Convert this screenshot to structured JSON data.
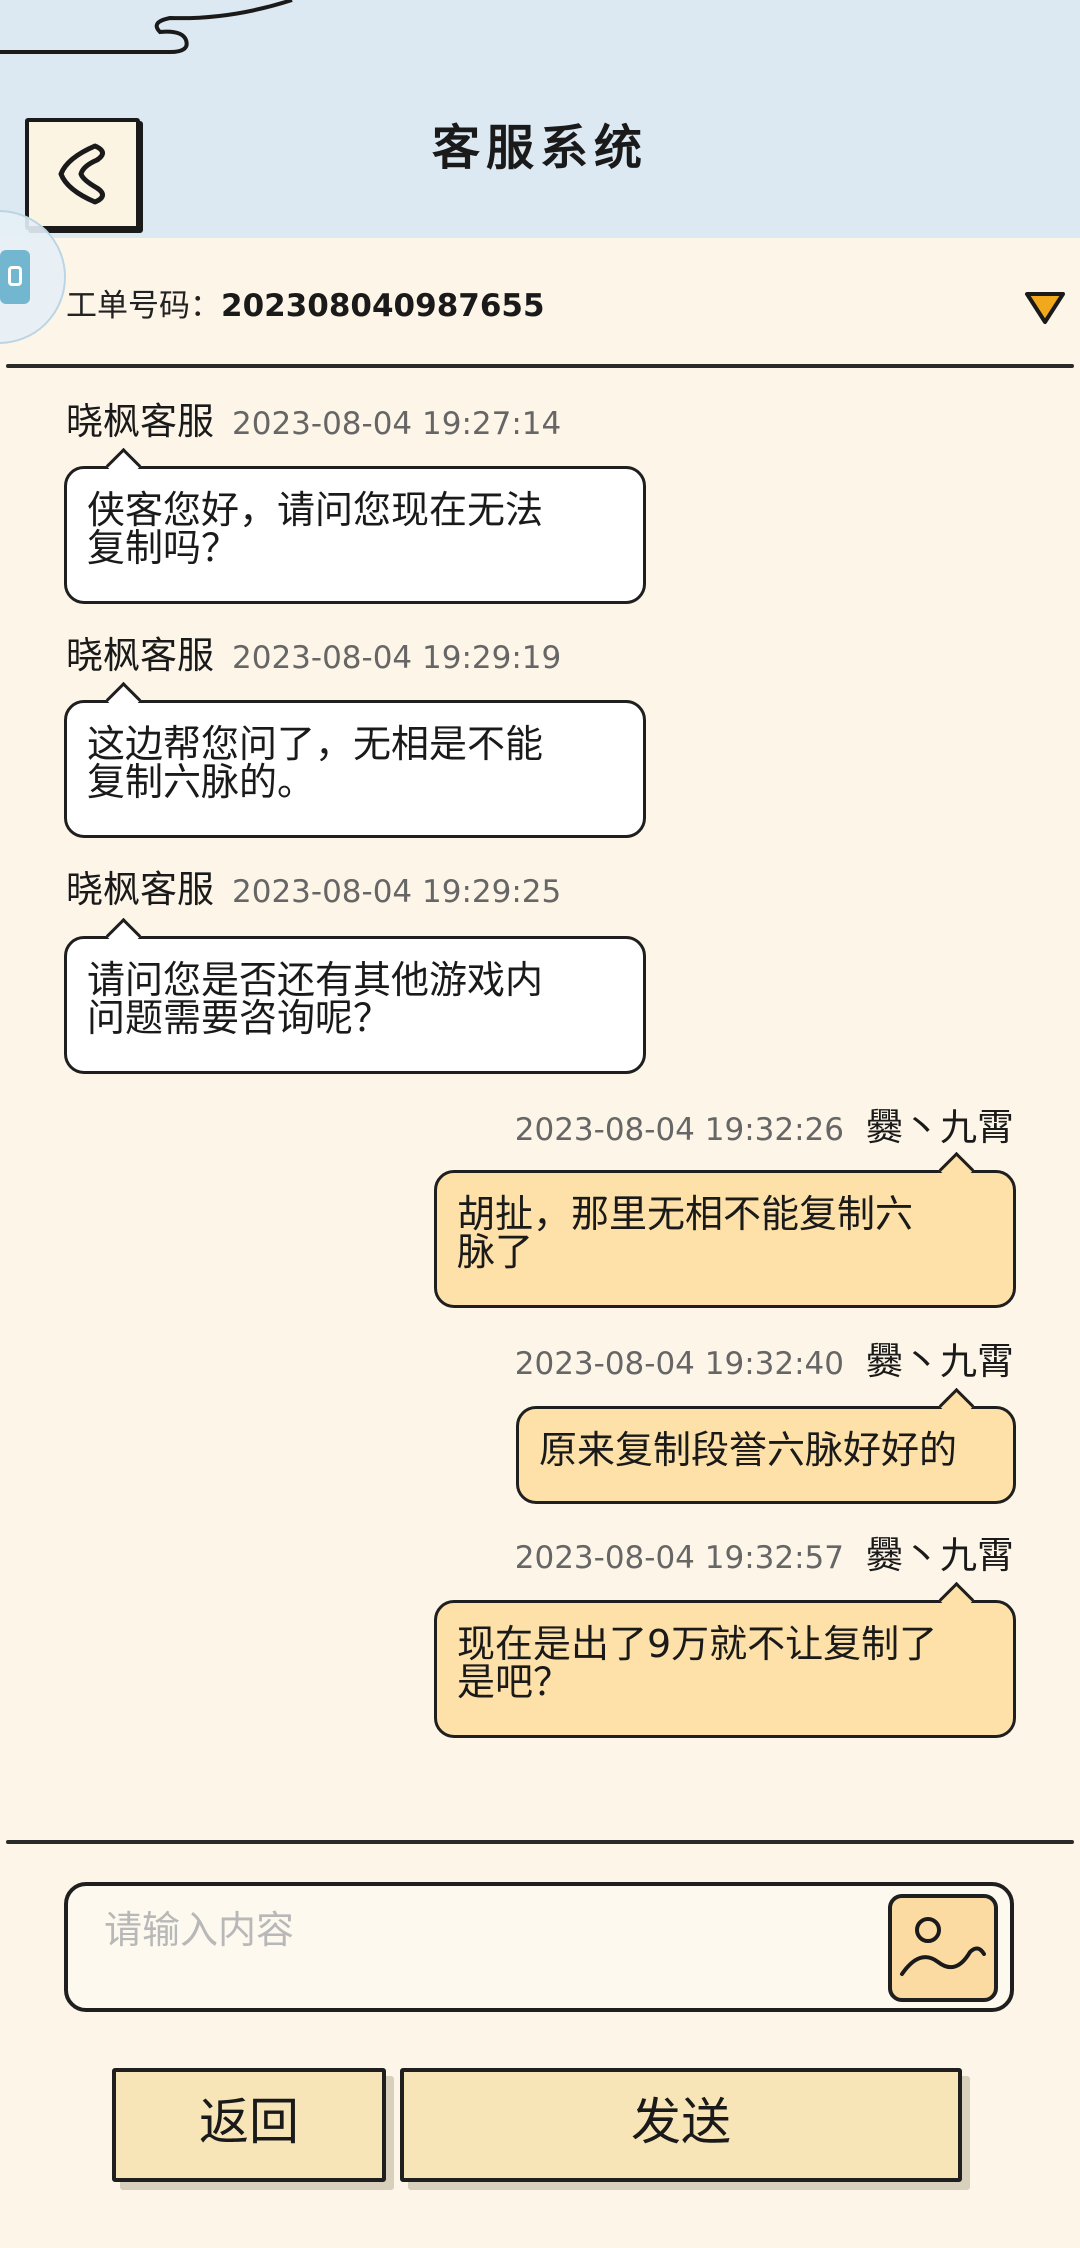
{
  "header": {
    "title": "客服系统"
  },
  "ticket": {
    "label": "工单号码：",
    "number": "202308040987655"
  },
  "messages": [
    {
      "side": "left",
      "sender": "晓枫客服",
      "time": "2023-08-04 19:27:14",
      "text_lines": [
        "侠客您好，请问您现在无法",
        "复制吗？"
      ]
    },
    {
      "side": "left",
      "sender": "晓枫客服",
      "time": "2023-08-04 19:29:19",
      "text_lines": [
        "这边帮您问了，无相是不能",
        "复制六脉的。"
      ]
    },
    {
      "side": "left",
      "sender": "晓枫客服",
      "time": "2023-08-04 19:29:25",
      "text_lines": [
        "请问您是否还有其他游戏内",
        "问题需要咨询呢？"
      ]
    },
    {
      "side": "right",
      "sender": "爨丶九霄",
      "time": "2023-08-04 19:32:26",
      "text_lines": [
        "胡扯，那里无相不能复制六",
        "脉了"
      ]
    },
    {
      "side": "right",
      "sender": "爨丶九霄",
      "time": "2023-08-04 19:32:40",
      "text_lines": [
        "原来复制段誉六脉好好的"
      ]
    },
    {
      "side": "right",
      "sender": "爨丶九霄",
      "time": "2023-08-04 19:32:57",
      "text_lines": [
        "现在是出了9万就不让复制了",
        "是吧？"
      ]
    }
  ],
  "input": {
    "placeholder": "请输入内容",
    "value": ""
  },
  "buttons": {
    "back": "返回",
    "send": "发送"
  },
  "colors": {
    "header_bg": "#dde9f2",
    "page_bg": "#fdf6e8",
    "user_bubble": "#fde1a8",
    "agent_bubble": "#ffffff",
    "button_bg": "#f7e5b8",
    "dropdown": "#f2a81d"
  }
}
